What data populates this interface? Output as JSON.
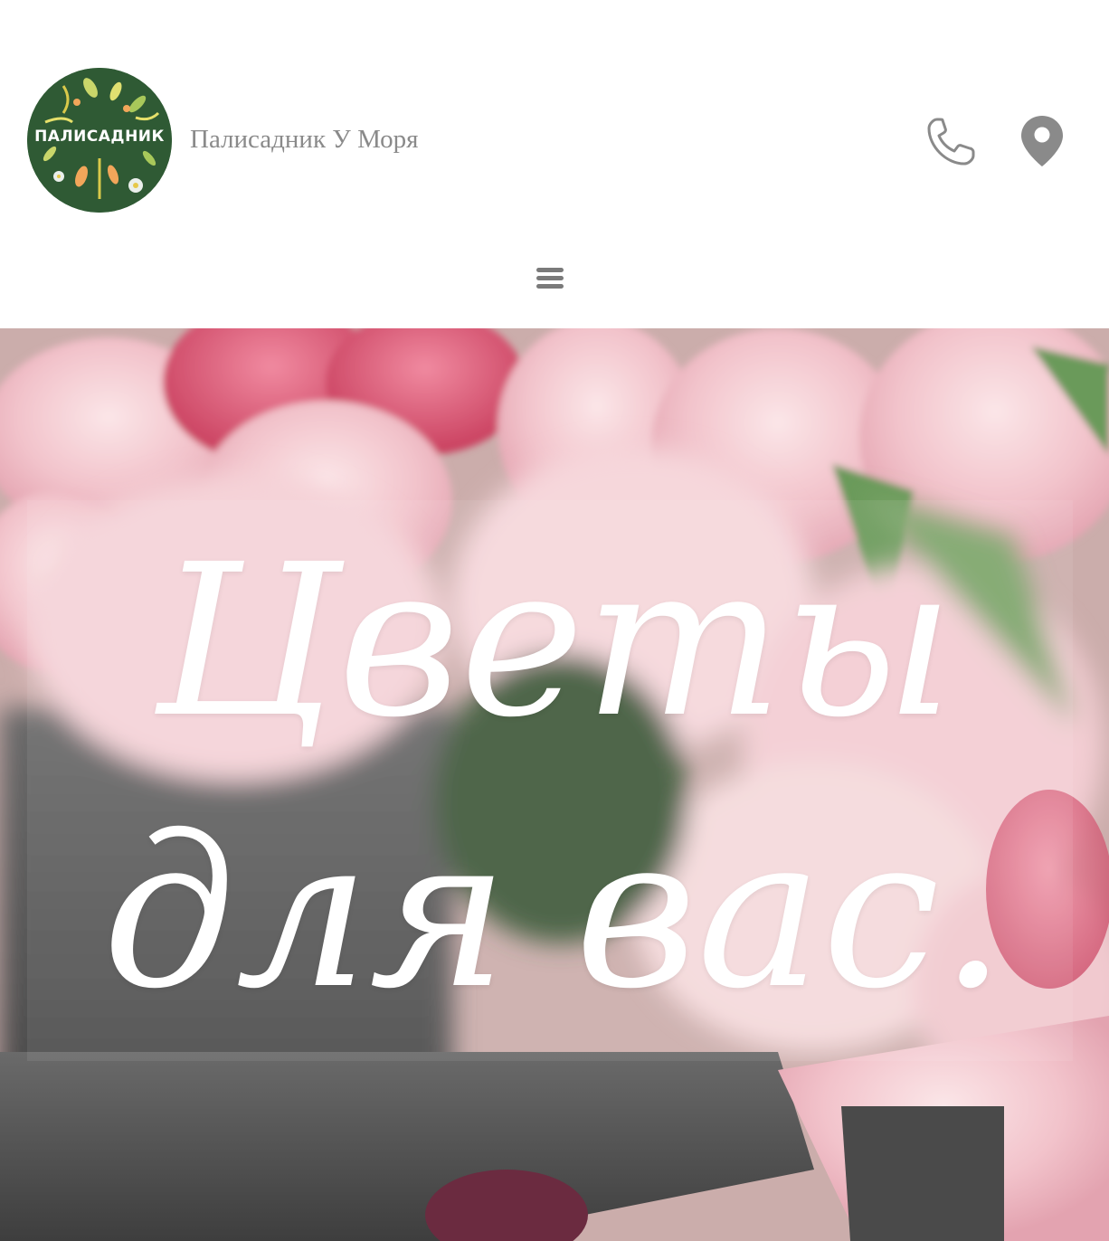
{
  "header": {
    "logo_text": "ПАЛИСАДНИК",
    "site_title": "Палисадник У Моря",
    "phone_icon": "phone-icon",
    "map_icon": "map-marker-icon",
    "menu_icon": "hamburger-menu-icon",
    "icon_color": "#8a8a8a"
  },
  "hero": {
    "line1": "Цветы",
    "line2": "для вас.",
    "text_color": "#ffffff"
  },
  "colors": {
    "logo_bg": "#2f5a34",
    "tulip_pink": "#f2c3cb",
    "tulip_deep": "#d9536e",
    "wrap_gray": "#5a5a5a"
  }
}
